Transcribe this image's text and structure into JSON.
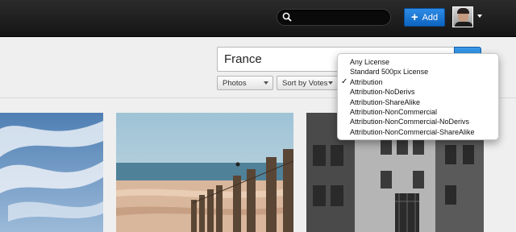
{
  "topbar": {
    "search_placeholder": "",
    "add_label": "Add"
  },
  "search": {
    "query": "France",
    "type_select": "Photos",
    "sort_select": "Sort by Votes"
  },
  "license_menu": {
    "selected_index": 2,
    "items": [
      "Any License",
      "Standard 500px License",
      "Attribution",
      "Attribution-NoDerivs",
      "Attribution-ShareAlike",
      "Attribution-NonCommercial",
      "Attribution-NonCommercial-NoDerivs",
      "Attribution-NonCommercial-ShareAlike"
    ]
  },
  "colors": {
    "add_button": "#1a76d2",
    "topbar": "#1e1e1e"
  },
  "icons": [
    "search-icon",
    "plus-icon",
    "chevron-down-icon",
    "checkmark-icon"
  ]
}
